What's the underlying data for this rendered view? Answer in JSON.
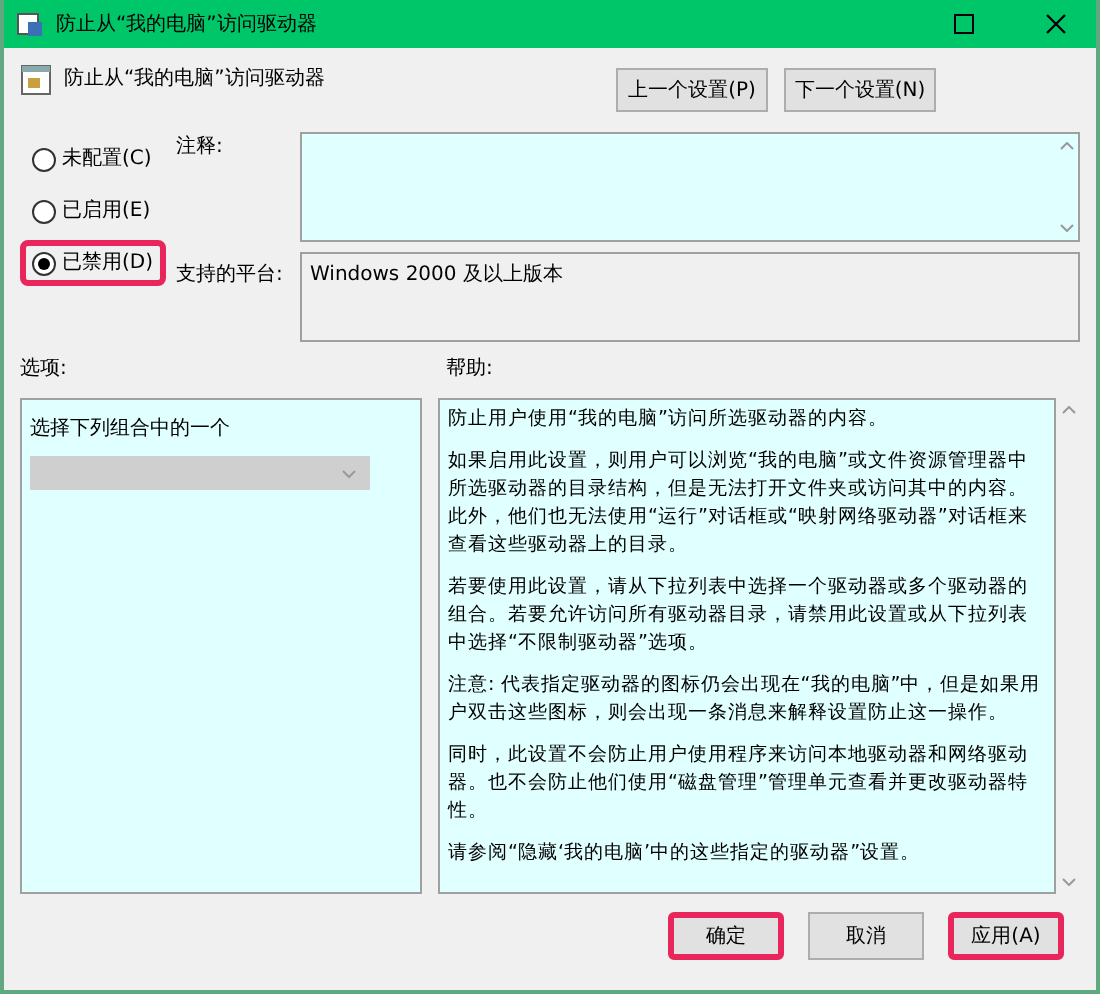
{
  "window": {
    "title": "防止从“我的电脑”访问驱动器"
  },
  "header": {
    "title": "防止从“我的电脑”访问驱动器",
    "nav_buttons": [
      "上一个设置(P)",
      "下一个设置(N)"
    ]
  },
  "states": [
    {
      "label": "未配置(C)",
      "selected": false,
      "highlighted": false
    },
    {
      "label": "已启用(E)",
      "selected": false,
      "highlighted": false
    },
    {
      "label": "已禁用(D)",
      "selected": true,
      "highlighted": true
    }
  ],
  "comment": {
    "label": "注释:"
  },
  "platform": {
    "label": "支持的平台:",
    "value": "Windows 2000 及以上版本"
  },
  "options": {
    "label": "选项:",
    "prompt": "选择下列组合中的一个",
    "dropdown_disabled": true
  },
  "help": {
    "label": "帮助:",
    "paragraphs": [
      "防止用户使用“我的电脑”访问所选驱动器的内容。",
      "如果启用此设置，则用户可以浏览“我的电脑”或文件资源管理器中所选驱动器的目录结构，但是无法打开文件夹或访问其中的内容。此外，他们也无法使用“运行”对话框或“映射网络驱动器”对话框来查看这些驱动器上的目录。",
      "若要使用此设置，请从下拉列表中选择一个驱动器或多个驱动器的组合。若要允许访问所有驱动器目录，请禁用此设置或从下拉列表中选择“不限制驱动器”选项。",
      "注意: 代表指定驱动器的图标仍会出现在“我的电脑”中，但是如果用户双击这些图标，则会出现一条消息来解释设置防止这一操作。",
      " 同时，此设置不会防止用户使用程序来访问本地驱动器和网络驱动器。也不会防止他们使用“磁盘管理”管理单元查看并更改驱动器特性。",
      "请参阅“隐藏‘我的电脑’中的这些指定的驱动器”设置。"
    ]
  },
  "buttons": [
    {
      "label": "确定",
      "highlighted": true
    },
    {
      "label": "取消",
      "highlighted": false
    },
    {
      "label": "应用(A)",
      "highlighted": true
    }
  ]
}
